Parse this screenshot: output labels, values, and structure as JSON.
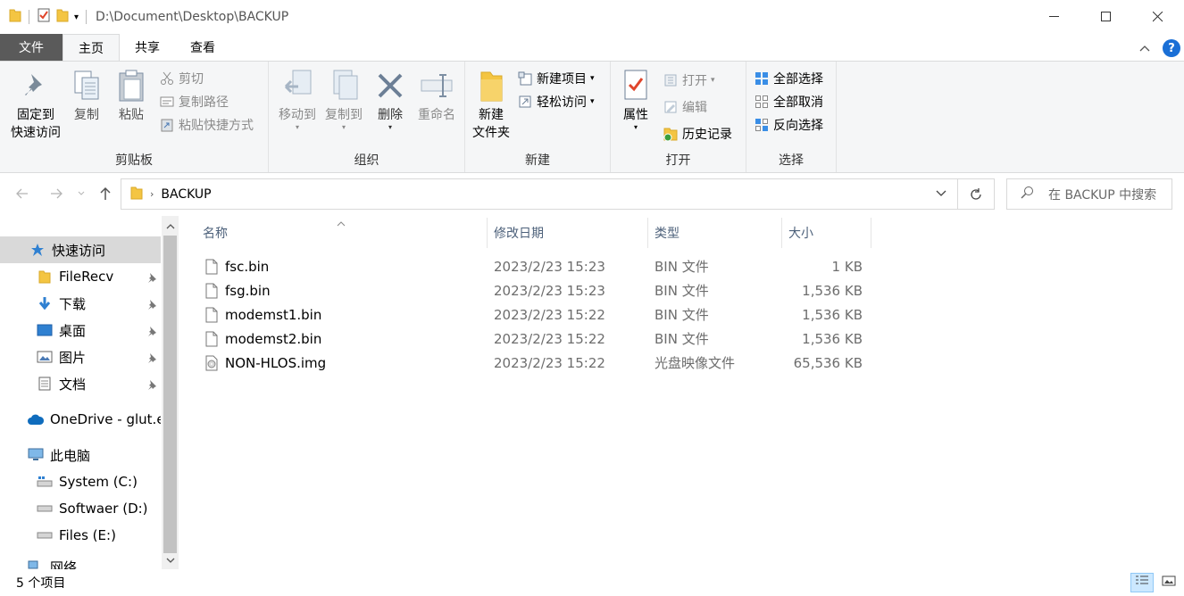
{
  "window": {
    "title": "D:\\Document\\Desktop\\BACKUP"
  },
  "tabs": [
    {
      "label": "文件"
    },
    {
      "label": "主页"
    },
    {
      "label": "共享"
    },
    {
      "label": "查看"
    }
  ],
  "ribbon": {
    "clipboard": {
      "pin_label_1": "固定到",
      "pin_label_2": "快速访问",
      "copy": "复制",
      "paste": "粘贴",
      "cut": "剪切",
      "copy_path": "复制路径",
      "paste_shortcut": "粘贴快捷方式",
      "group": "剪贴板"
    },
    "organize": {
      "move_to": "移动到",
      "copy_to": "复制到",
      "delete": "删除",
      "rename": "重命名",
      "group": "组织"
    },
    "new": {
      "new_folder_1": "新建",
      "new_folder_2": "文件夹",
      "new_item": "新建项目",
      "easy_access": "轻松访问",
      "group": "新建"
    },
    "open": {
      "properties": "属性",
      "open": "打开",
      "edit": "编辑",
      "history": "历史记录",
      "group": "打开"
    },
    "select": {
      "select_all": "全部选择",
      "select_none": "全部取消",
      "invert": "反向选择",
      "group": "选择"
    }
  },
  "address": {
    "crumb": "BACKUP",
    "search_placeholder": "在 BACKUP 中搜索"
  },
  "navpane": {
    "quick_access": "快速访问",
    "items": [
      {
        "label": "FileRecv"
      },
      {
        "label": "下载"
      },
      {
        "label": "桌面"
      },
      {
        "label": "图片"
      },
      {
        "label": "文档"
      }
    ],
    "onedrive": "OneDrive - glut.e",
    "this_pc": "此电脑",
    "drives": [
      {
        "label": "System (C:)"
      },
      {
        "label": "Softwaer (D:)"
      },
      {
        "label": "Files (E:)"
      }
    ],
    "network": "网络"
  },
  "columns": {
    "name": "名称",
    "date": "修改日期",
    "type": "类型",
    "size": "大小"
  },
  "files": [
    {
      "name": "fsc.bin",
      "date": "2023/2/23 15:23",
      "type": "BIN 文件",
      "size": "1 KB"
    },
    {
      "name": "fsg.bin",
      "date": "2023/2/23 15:23",
      "type": "BIN 文件",
      "size": "1,536 KB"
    },
    {
      "name": "modemst1.bin",
      "date": "2023/2/23 15:22",
      "type": "BIN 文件",
      "size": "1,536 KB"
    },
    {
      "name": "modemst2.bin",
      "date": "2023/2/23 15:22",
      "type": "BIN 文件",
      "size": "1,536 KB"
    },
    {
      "name": "NON-HLOS.img",
      "date": "2023/2/23 15:22",
      "type": "光盘映像文件",
      "size": "65,536 KB"
    }
  ],
  "status": {
    "count": "5 个项目"
  }
}
